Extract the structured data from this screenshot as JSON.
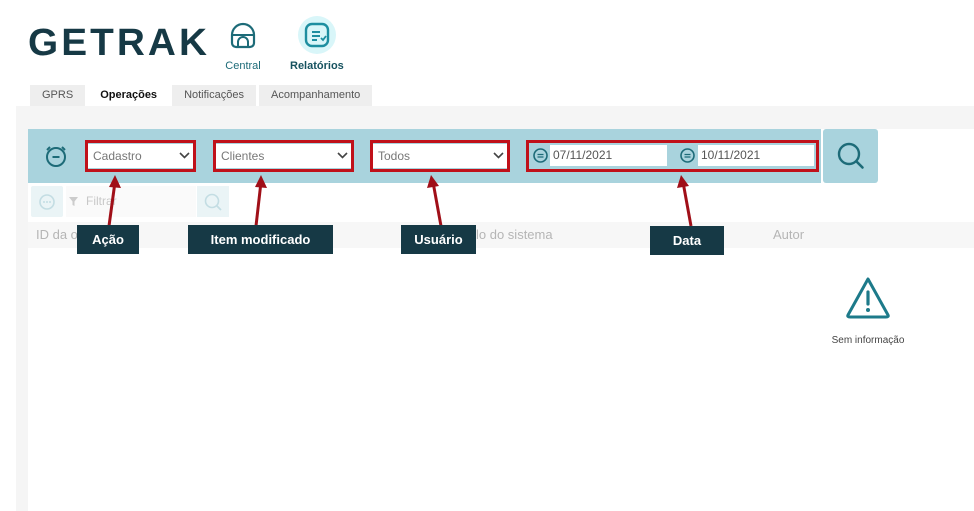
{
  "brand": {
    "logo_text": "GETRAK"
  },
  "nav": {
    "central_label": "Central",
    "relatorios_label": "Relatórios"
  },
  "tabs": [
    {
      "label": "GPRS"
    },
    {
      "label": "Operações"
    },
    {
      "label": "Notificações"
    },
    {
      "label": "Acompanhamento"
    }
  ],
  "filters": {
    "acao_value": "Cadastro",
    "item_value": "Clientes",
    "usuario_value": "Todos",
    "date_from": "07/11/2021",
    "date_to": "10/11/2021"
  },
  "toolbar": {
    "filter_placeholder": "Filtrar"
  },
  "table": {
    "col_id": "ID da o",
    "col_modulo": "lo do sistema",
    "col_autor": "Autor"
  },
  "empty": {
    "text": "Sem informação"
  },
  "callouts": {
    "acao": "Ação",
    "item": "Item modificado",
    "usuario": "Usuário",
    "data": "Data"
  },
  "colors": {
    "accent": "#a9d3dd",
    "brand_dark": "#163945",
    "highlight": "#c0111a"
  }
}
